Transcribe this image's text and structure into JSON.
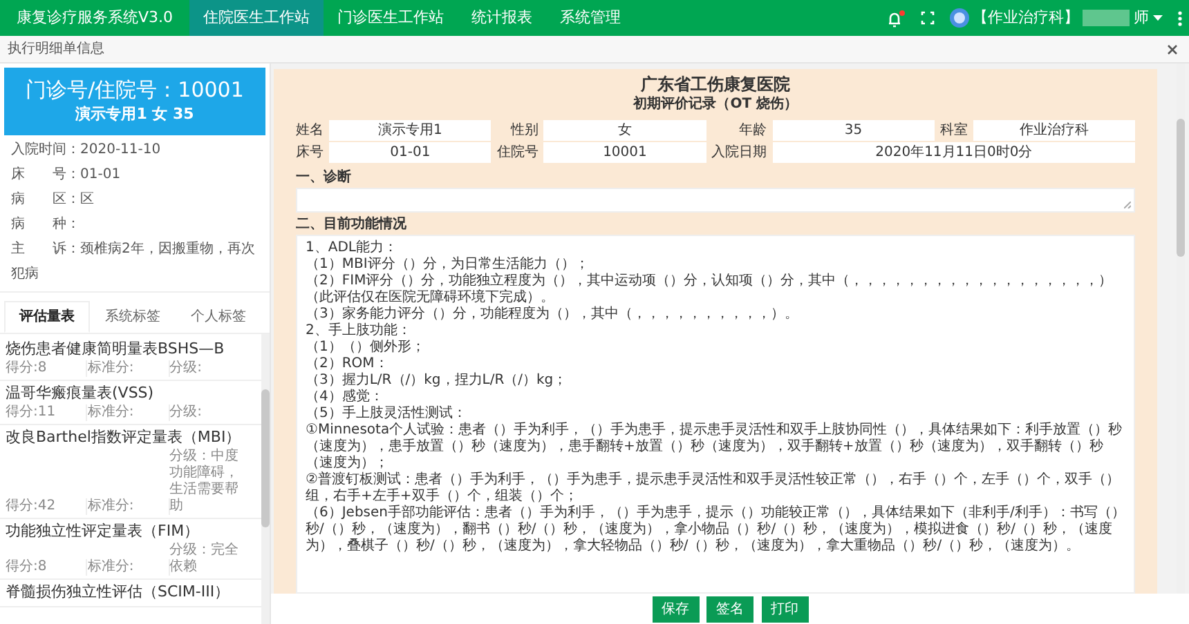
{
  "app": {
    "title": "康复诊疗服务系统V3.0"
  },
  "nav_tabs": [
    {
      "label": "住院医生工作站",
      "selected": true
    },
    {
      "label": "门诊医生工作站",
      "selected": false
    },
    {
      "label": "统计报表",
      "selected": false
    },
    {
      "label": "系统管理",
      "selected": false
    }
  ],
  "notifications": {
    "unread": true
  },
  "user": {
    "department": "【作业治疗科】",
    "name": "师"
  },
  "breadcrumb": "执行明细单信息",
  "patient": {
    "id_line": "门诊号/住院号：10001",
    "summary": "演示专用1 女 35",
    "info": [
      {
        "label": "入院时间：",
        "value": "2020-11-10"
      },
      {
        "label": "床　　号：",
        "value": "01-01"
      },
      {
        "label": "病　　区：",
        "value": "区"
      },
      {
        "label": "病　　种："
      },
      {
        "label": "主　　诉：",
        "value": "颈椎病2年，因搬重物，再次犯病"
      }
    ]
  },
  "side_tabs": [
    {
      "label": "评估量表",
      "selected": true
    },
    {
      "label": "系统标签",
      "selected": false
    },
    {
      "label": "个人标签",
      "selected": false
    }
  ],
  "scales": [
    {
      "title": "烧伤患者健康简明量表BSHS—B",
      "score": "得分:8",
      "standard": "标准分:",
      "grade": "分级:"
    },
    {
      "title": "温哥华瘢痕量表(VSS)",
      "score": "得分:11",
      "standard": "标准分:",
      "grade": "分级:"
    },
    {
      "title": "改良Barthel指数评定量表（MBI）",
      "score": "得分:42",
      "standard": "标准分:",
      "grade": "分级：中度功能障碍，生活需要帮助"
    },
    {
      "title": "功能独立性评定量表（FIM）",
      "score": "得分:8",
      "standard": "标准分:",
      "grade": "分级：完全依赖"
    },
    {
      "title": "脊髓损伤独立性评估（SCIM-III）"
    }
  ],
  "document": {
    "hospital": "广东省工伤康复医院",
    "subtitle": "初期评价记录（OT 烧伤）",
    "fields": [
      {
        "label": "姓名",
        "value": "演示专用1"
      },
      {
        "label": "性别",
        "value": "女"
      },
      {
        "label": "年龄",
        "value": "35"
      },
      {
        "label": "科室",
        "value": "作业治疗科"
      },
      {
        "label": "床号",
        "value": "01-01"
      },
      {
        "label": "住院号",
        "value": "10001"
      },
      {
        "label": "入院日期",
        "value": "2020年11月11日0时0分"
      }
    ],
    "sections": [
      {
        "heading": "一、诊断"
      },
      {
        "heading": "二、目前功能情况",
        "lines": [
          "1、ADL能力：",
          "（1）MBI评分（）分，为日常生活能力（）；",
          "（2）FIM评分（）分，功能独立程度为（），其中运动项（）分，认知项（）分，其中（，，，，，，，，，，，，，，，，，，）（此评估仅在医院无障碍环境下完成）。",
          "（3）家务能力评分（）分，功能程度为（），其中（，，，，，，，，，，）。",
          "2、手上肢功能：",
          "（1）（）侧外形；",
          "（2）ROM：",
          "（3）握力L/R（/）kg，捏力L/R（/）kg；",
          "（4）感觉：",
          "（5）手上肢灵活性测试：",
          "①Minnesota个人试验：患者（）手为利手，（）手为患手，提示患手灵活性和双手上肢协同性（），具体结果如下：利手放置（）秒（速度为），患手放置（）秒（速度为），患手翻转+放置（）秒（速度为），双手翻转+放置（）秒（速度为），双手翻转（）秒（速度为）；",
          "②普渡钉板测试：患者（）手为利手，（）手为患手，提示患手灵活性和双手灵活性较正常（），右手（）个，左手（）个，双手（）组，右手+左手+双手（）个，组装（）个；",
          "（6）Jebsen手部功能评估：患者（）手为利手，（）手为患手，提示（）功能较正常（），具体结果如下（非利手/利手）：书写（）秒/（）秒，（速度为），翻书（）秒/（）秒，（速度为），拿小物品（）秒/（）秒，（速度为），模拟进食（）秒/（）秒，（速度为），叠棋子（）秒/（）秒，（速度为），拿大轻物品（）秒/（）秒，（速度为），拿大重物品（）秒/（）秒，（速度为）。"
        ]
      }
    ]
  },
  "buttons": [
    "保存",
    "签名",
    "打印"
  ]
}
